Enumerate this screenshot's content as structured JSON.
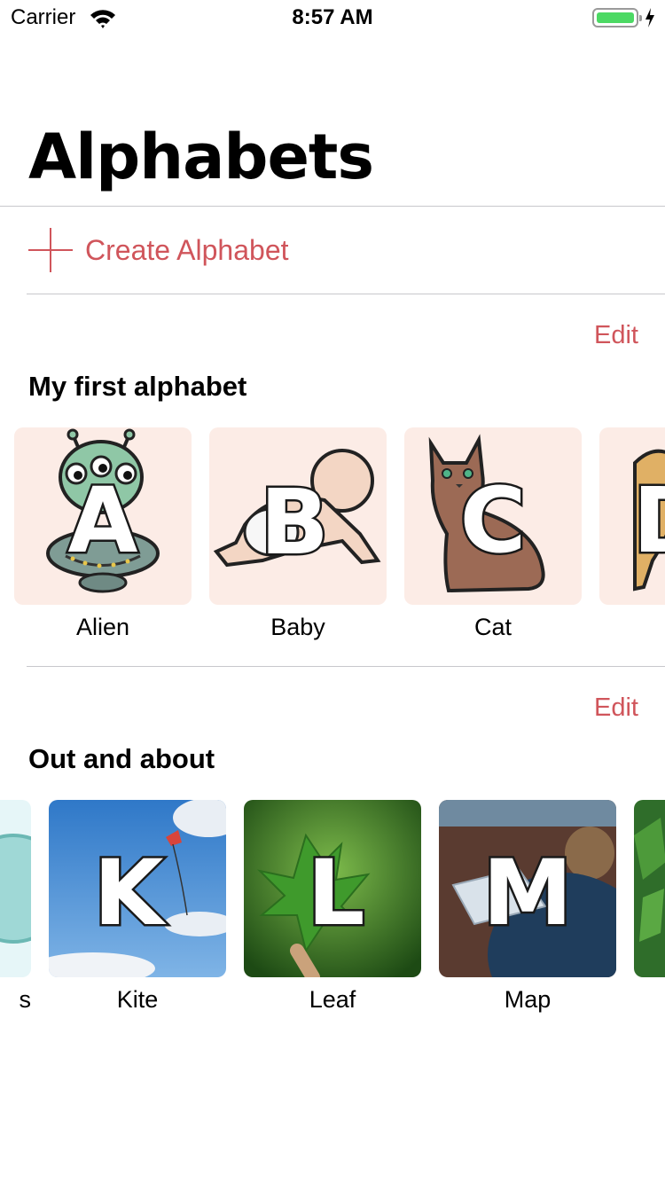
{
  "status_bar": {
    "carrier": "Carrier",
    "time": "8:57 AM",
    "battery_color": "#4cd964"
  },
  "header": {
    "title": "Alphabets"
  },
  "create": {
    "label": "Create Alphabet",
    "icon": "plus-icon"
  },
  "accent_color": "#d0555b",
  "sections": [
    {
      "title": "My first alphabet",
      "edit_label": "Edit",
      "items": [
        {
          "letter": "A",
          "label": "Alien"
        },
        {
          "letter": "B",
          "label": "Baby"
        },
        {
          "letter": "C",
          "label": "Cat"
        },
        {
          "letter": "D",
          "label": ""
        }
      ]
    },
    {
      "title": "Out and about",
      "edit_label": "Edit",
      "items": [
        {
          "letter": "",
          "label": "s"
        },
        {
          "letter": "K",
          "label": "Kite"
        },
        {
          "letter": "L",
          "label": "Leaf"
        },
        {
          "letter": "M",
          "label": "Map"
        },
        {
          "letter": "",
          "label": ""
        }
      ]
    }
  ]
}
